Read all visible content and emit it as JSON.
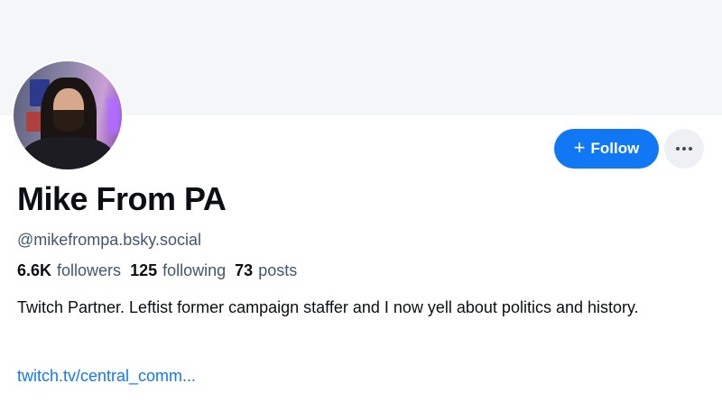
{
  "profile": {
    "display_name": "Mike From PA",
    "handle": "@mikefrompa.bsky.social",
    "bio": "Twitch Partner. Leftist former campaign staffer and I now yell about politics and history.",
    "link": "twitch.tv/central_comm...",
    "avatar_icon": "avatar-photo"
  },
  "stats": {
    "followers_count": "6.6K",
    "followers_label": "followers",
    "following_count": "125",
    "following_label": "following",
    "posts_count": "73",
    "posts_label": "posts"
  },
  "actions": {
    "follow_label": "Follow",
    "follow_icon": "plus-icon",
    "more_icon": "ellipsis-icon"
  },
  "colors": {
    "accent": "#1078f5",
    "banner": "#f5f6f8",
    "secondary_text": "#42576c"
  }
}
